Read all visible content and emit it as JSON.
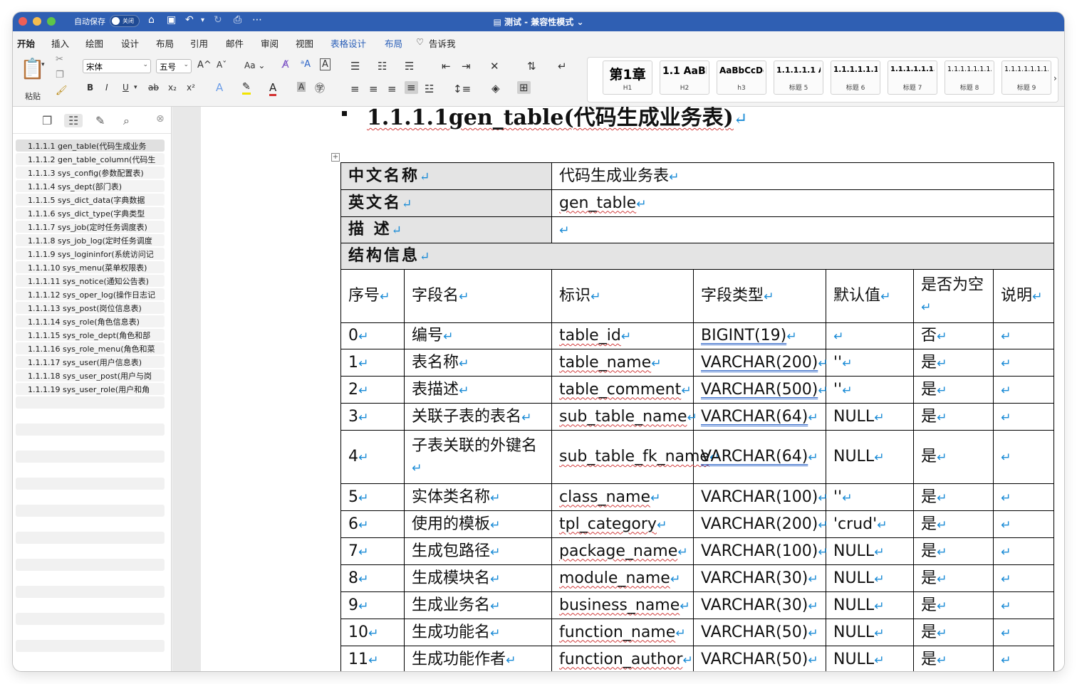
{
  "titlebar": {
    "autosave_label": "自动保存",
    "toggle_label": "关闭",
    "doc_title": "测试 - 兼容性模式"
  },
  "tabs": [
    "开始",
    "插入",
    "绘图",
    "设计",
    "布局",
    "引用",
    "邮件",
    "审阅",
    "视图",
    "表格设计",
    "布局",
    "告诉我"
  ],
  "ribbon": {
    "paste_label": "粘贴",
    "font_name": "宋体",
    "font_size": "五号",
    "aa_label": "Aa"
  },
  "styles": [
    {
      "preview": "第1章",
      "label": "H1"
    },
    {
      "preview": "1.1  AaBl",
      "label": "H2"
    },
    {
      "preview": "AaBbCcDd",
      "label": "h3"
    },
    {
      "preview": "1.1.1.1.1 A",
      "label": "标题 5"
    },
    {
      "preview": "1.1.1.1.1.1",
      "label": "标题 6"
    },
    {
      "preview": "1.1.1.1.1.1.1",
      "label": "标题 7"
    },
    {
      "preview": "1.1.1.1.1.1.1.",
      "label": "标题 8"
    },
    {
      "preview": "1.1.1.1.1.1.1.",
      "label": "标题 9"
    }
  ],
  "nav": [
    "1.1.1.1 gen_table(代码生成业务",
    "1.1.1.2 gen_table_column(代码生",
    "1.1.1.3 sys_config(参数配置表)",
    "1.1.1.4 sys_dept(部门表)",
    "1.1.1.5 sys_dict_data(字典数据",
    "1.1.1.6 sys_dict_type(字典类型",
    "1.1.1.7 sys_job(定时任务调度表)",
    "1.1.1.8 sys_job_log(定时任务调度",
    "1.1.1.9 sys_logininfor(系统访问记",
    "1.1.1.10 sys_menu(菜单权限表)",
    "1.1.1.11 sys_notice(通知公告表)",
    "1.1.1.12 sys_oper_log(操作日志记",
    "1.1.1.13 sys_post(岗位信息表)",
    "1.1.1.14 sys_role(角色信息表)",
    "1.1.1.15 sys_role_dept(角色和部",
    "1.1.1.16 sys_role_menu(角色和菜",
    "1.1.1.17 sys_user(用户信息表)",
    "1.1.1.18 sys_user_post(用户与岗",
    "1.1.1.19 sys_user_role(用户和角"
  ],
  "doc": {
    "heading": "1.1.1.1gen_table(代码生成业务表)",
    "meta": {
      "cn_name_label": "中文名称",
      "cn_name": "代码生成业务表",
      "en_name_label": "英文名",
      "en_name": "gen_table",
      "desc_label": "描 述",
      "desc": "",
      "struct_label": "结构信息"
    },
    "columns": [
      "序号",
      "字段名",
      "标识",
      "字段类型",
      "默认值",
      "是否为空",
      "说明"
    ],
    "rows": [
      [
        "0",
        "编号",
        "table_id",
        "BIGINT(19)",
        "",
        "否",
        ""
      ],
      [
        "1",
        "表名称",
        "table_name",
        "VARCHAR(200)",
        "''",
        "是",
        ""
      ],
      [
        "2",
        "表描述",
        "table_comment",
        "VARCHAR(500)",
        "''",
        "是",
        ""
      ],
      [
        "3",
        "关联子表的表名",
        "sub_table_name",
        "VARCHAR(64)",
        "NULL",
        "是",
        ""
      ],
      [
        "4",
        "子表关联的外键名",
        "sub_table_fk_name",
        "VARCHAR(64)",
        "NULL",
        "是",
        ""
      ],
      [
        "5",
        "实体类名称",
        "class_name",
        "VARCHAR(100)",
        "''",
        "是",
        ""
      ],
      [
        "6",
        "使用的模板",
        "tpl_category",
        "VARCHAR(200)",
        "'crud'",
        "是",
        ""
      ],
      [
        "7",
        "生成包路径",
        "package_name",
        "VARCHAR(100)",
        "NULL",
        "是",
        ""
      ],
      [
        "8",
        "生成模块名",
        "module_name",
        "VARCHAR(30)",
        "NULL",
        "是",
        ""
      ],
      [
        "9",
        "生成业务名",
        "business_name",
        "VARCHAR(30)",
        "NULL",
        "是",
        ""
      ],
      [
        "10",
        "生成功能名",
        "function_name",
        "VARCHAR(50)",
        "NULL",
        "是",
        ""
      ],
      [
        "11",
        "生成功能作者",
        "function_author",
        "VARCHAR(50)",
        "NULL",
        "是",
        ""
      ]
    ]
  }
}
